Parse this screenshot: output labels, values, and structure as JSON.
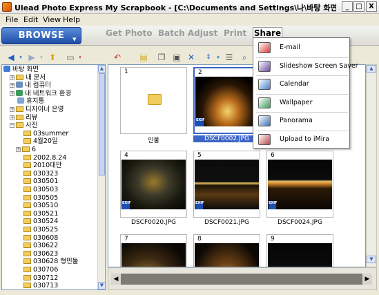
{
  "window": {
    "title": "Ulead Photo Express My Scrapbook - [C:\\Documents and Settings\\나\\바탕 화면\\사진...",
    "minimize": "_",
    "maximize": "□",
    "close": "X"
  },
  "menubar": {
    "file": "File",
    "edit": "Edit",
    "view": "View",
    "help": "Help"
  },
  "nav": {
    "browse": "BROWSE",
    "tabs": [
      "Get Photo",
      "Batch Adjust",
      "Print"
    ],
    "share": "Share"
  },
  "tree": [
    {
      "label": "바탕 화면",
      "icon": "desktop-icon",
      "exp": "",
      "indent": 0
    },
    {
      "label": "내 문서",
      "icon": "documents-folder-icon",
      "exp": "+",
      "indent": 1
    },
    {
      "label": "내 컴퓨터",
      "icon": "computer-icon",
      "exp": "+",
      "indent": 1
    },
    {
      "label": "내 네트워크 환경",
      "icon": "network-icon",
      "exp": "+",
      "indent": 1
    },
    {
      "label": "휴지통",
      "icon": "recycle-bin-icon",
      "exp": "",
      "indent": 1
    },
    {
      "label": "디자이너 은영",
      "icon": "folder-icon",
      "exp": "+",
      "indent": 1
    },
    {
      "label": "리뷰",
      "icon": "folder-icon",
      "exp": "+",
      "indent": 1
    },
    {
      "label": "사진",
      "icon": "folder-icon",
      "exp": "-",
      "indent": 1
    },
    {
      "label": "03summer",
      "icon": "folder-icon",
      "exp": "",
      "indent": 2
    },
    {
      "label": "4월20일",
      "icon": "folder-icon",
      "exp": "",
      "indent": 2
    },
    {
      "label": "6",
      "icon": "folder-icon",
      "exp": "+",
      "indent": 2
    },
    {
      "label": "2002.8.24",
      "icon": "folder-icon",
      "exp": "",
      "indent": 2
    },
    {
      "label": "2010대만",
      "icon": "folder-icon",
      "exp": "",
      "indent": 2
    },
    {
      "label": "030323",
      "icon": "folder-icon",
      "exp": "",
      "indent": 2
    },
    {
      "label": "030501",
      "icon": "folder-icon",
      "exp": "",
      "indent": 2
    },
    {
      "label": "030503",
      "icon": "folder-icon",
      "exp": "",
      "indent": 2
    },
    {
      "label": "030505",
      "icon": "folder-icon",
      "exp": "",
      "indent": 2
    },
    {
      "label": "030510",
      "icon": "folder-icon",
      "exp": "",
      "indent": 2
    },
    {
      "label": "030521",
      "icon": "folder-icon",
      "exp": "",
      "indent": 2
    },
    {
      "label": "030524",
      "icon": "folder-icon",
      "exp": "",
      "indent": 2
    },
    {
      "label": "030525",
      "icon": "folder-icon",
      "exp": "",
      "indent": 2
    },
    {
      "label": "030608",
      "icon": "folder-icon",
      "exp": "",
      "indent": 2
    },
    {
      "label": "030622",
      "icon": "folder-icon",
      "exp": "",
      "indent": 2
    },
    {
      "label": "030623",
      "icon": "folder-icon",
      "exp": "",
      "indent": 2
    },
    {
      "label": "030628 형민돌",
      "icon": "folder-icon",
      "exp": "",
      "indent": 2
    },
    {
      "label": "030706",
      "icon": "folder-icon",
      "exp": "",
      "indent": 2
    },
    {
      "label": "030712",
      "icon": "folder-icon",
      "exp": "",
      "indent": 2
    },
    {
      "label": "030713",
      "icon": "folder-icon",
      "exp": "",
      "indent": 2
    }
  ],
  "thumbnails": [
    {
      "num": "1",
      "label": "인물",
      "type": "folder",
      "selected": false
    },
    {
      "num": "2",
      "label": "DSCF0002.JPG",
      "type": "photo",
      "selected": true
    },
    {
      "num": "4",
      "label": "DSCF0020.JPG",
      "type": "photo",
      "selected": false
    },
    {
      "num": "5",
      "label": "DSCF0021.JPG",
      "type": "photo",
      "selected": false
    },
    {
      "num": "6",
      "label": "DSCF0024.JPG",
      "type": "photo",
      "selected": false
    },
    {
      "num": "7",
      "label": "",
      "type": "photo",
      "selected": false
    },
    {
      "num": "8",
      "label": "",
      "type": "photo",
      "selected": false
    },
    {
      "num": "9",
      "label": "",
      "type": "photo",
      "selected": false
    }
  ],
  "exif_badge": "EXIF",
  "share_menu": [
    {
      "label": "E-mail",
      "icon": "email-icon"
    },
    {
      "label": "Slideshow Screen Saver",
      "icon": "slideshow-icon"
    },
    {
      "label": "Calendar",
      "icon": "calendar-icon"
    },
    {
      "label": "Wallpaper",
      "icon": "wallpaper-icon"
    },
    {
      "label": "Panorama",
      "icon": "panorama-icon"
    },
    {
      "label": "Upload to iMira",
      "icon": "imira-icon"
    }
  ],
  "colors": {
    "selection": "#3c64c8",
    "browse": "#1e4ea8",
    "folder": "#f2cc5c"
  }
}
